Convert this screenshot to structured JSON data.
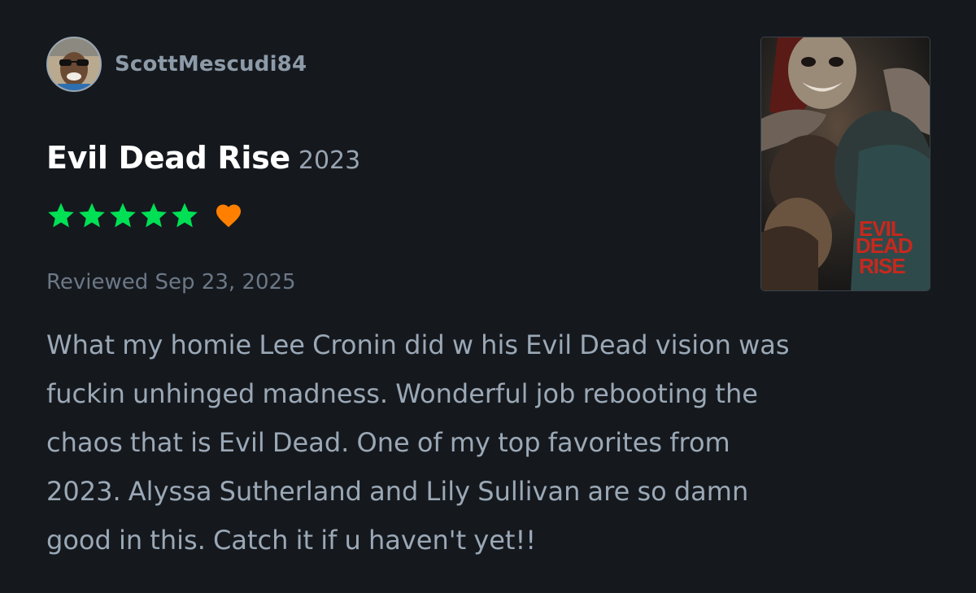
{
  "review": {
    "username": "ScottMescudi84",
    "film_title": "Evil Dead Rise",
    "film_year": "2023",
    "rating": 5,
    "rating_max": 5,
    "liked": true,
    "reviewed_date": "Reviewed Sep 23, 2025",
    "text": "What my homie Lee Cronin did w his Evil Dead vision was\nfuckin unhinged madness.  Wonderful job rebooting the\nchaos that is Evil Dead.  One of my top favorites from\n2023.  Alyssa Sutherland and Lily Sullivan are so damn\ngood in this.  Catch it if u haven't yet!!"
  },
  "poster": {
    "title_lines": [
      "EVIL",
      "DEAD",
      "RISE"
    ]
  },
  "colors": {
    "background": "#15191e",
    "star": "#00e054",
    "heart": "#ff8000",
    "username": "#8d9aa8",
    "poster_title": "#c8281e"
  },
  "icons": {
    "star": "star-icon",
    "heart": "heart-icon"
  }
}
